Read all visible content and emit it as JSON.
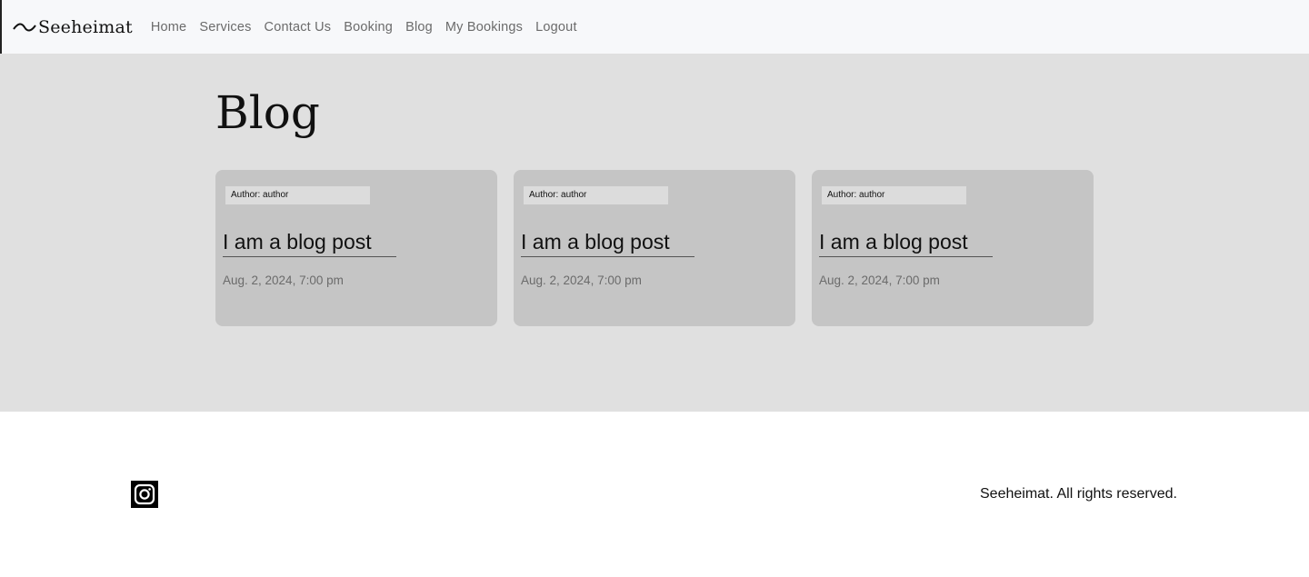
{
  "navbar": {
    "brand": "Seeheimat",
    "links": [
      "Home",
      "Services",
      "Contact Us",
      "Booking",
      "Blog",
      "My Bookings",
      "Logout"
    ]
  },
  "page": {
    "title": "Blog"
  },
  "posts": [
    {
      "author": "Author: author",
      "title": "I am a blog post",
      "date": "Aug. 2, 2024, 7:00 pm"
    },
    {
      "author": "Author: author",
      "title": "I am a blog post",
      "date": "Aug. 2, 2024, 7:00 pm"
    },
    {
      "author": "Author: author",
      "title": "I am a blog post",
      "date": "Aug. 2, 2024, 7:00 pm"
    }
  ],
  "footer": {
    "social_icon": "instagram-icon",
    "copyright": "Seeheimat. All rights reserved."
  },
  "colors": {
    "navbar_bg": "#f7f8fa",
    "main_bg": "#e0e0e0",
    "card_bg": "#c5c5c5",
    "author_badge_bg": "#dcdcdc",
    "muted_text": "#6b6b6b"
  }
}
